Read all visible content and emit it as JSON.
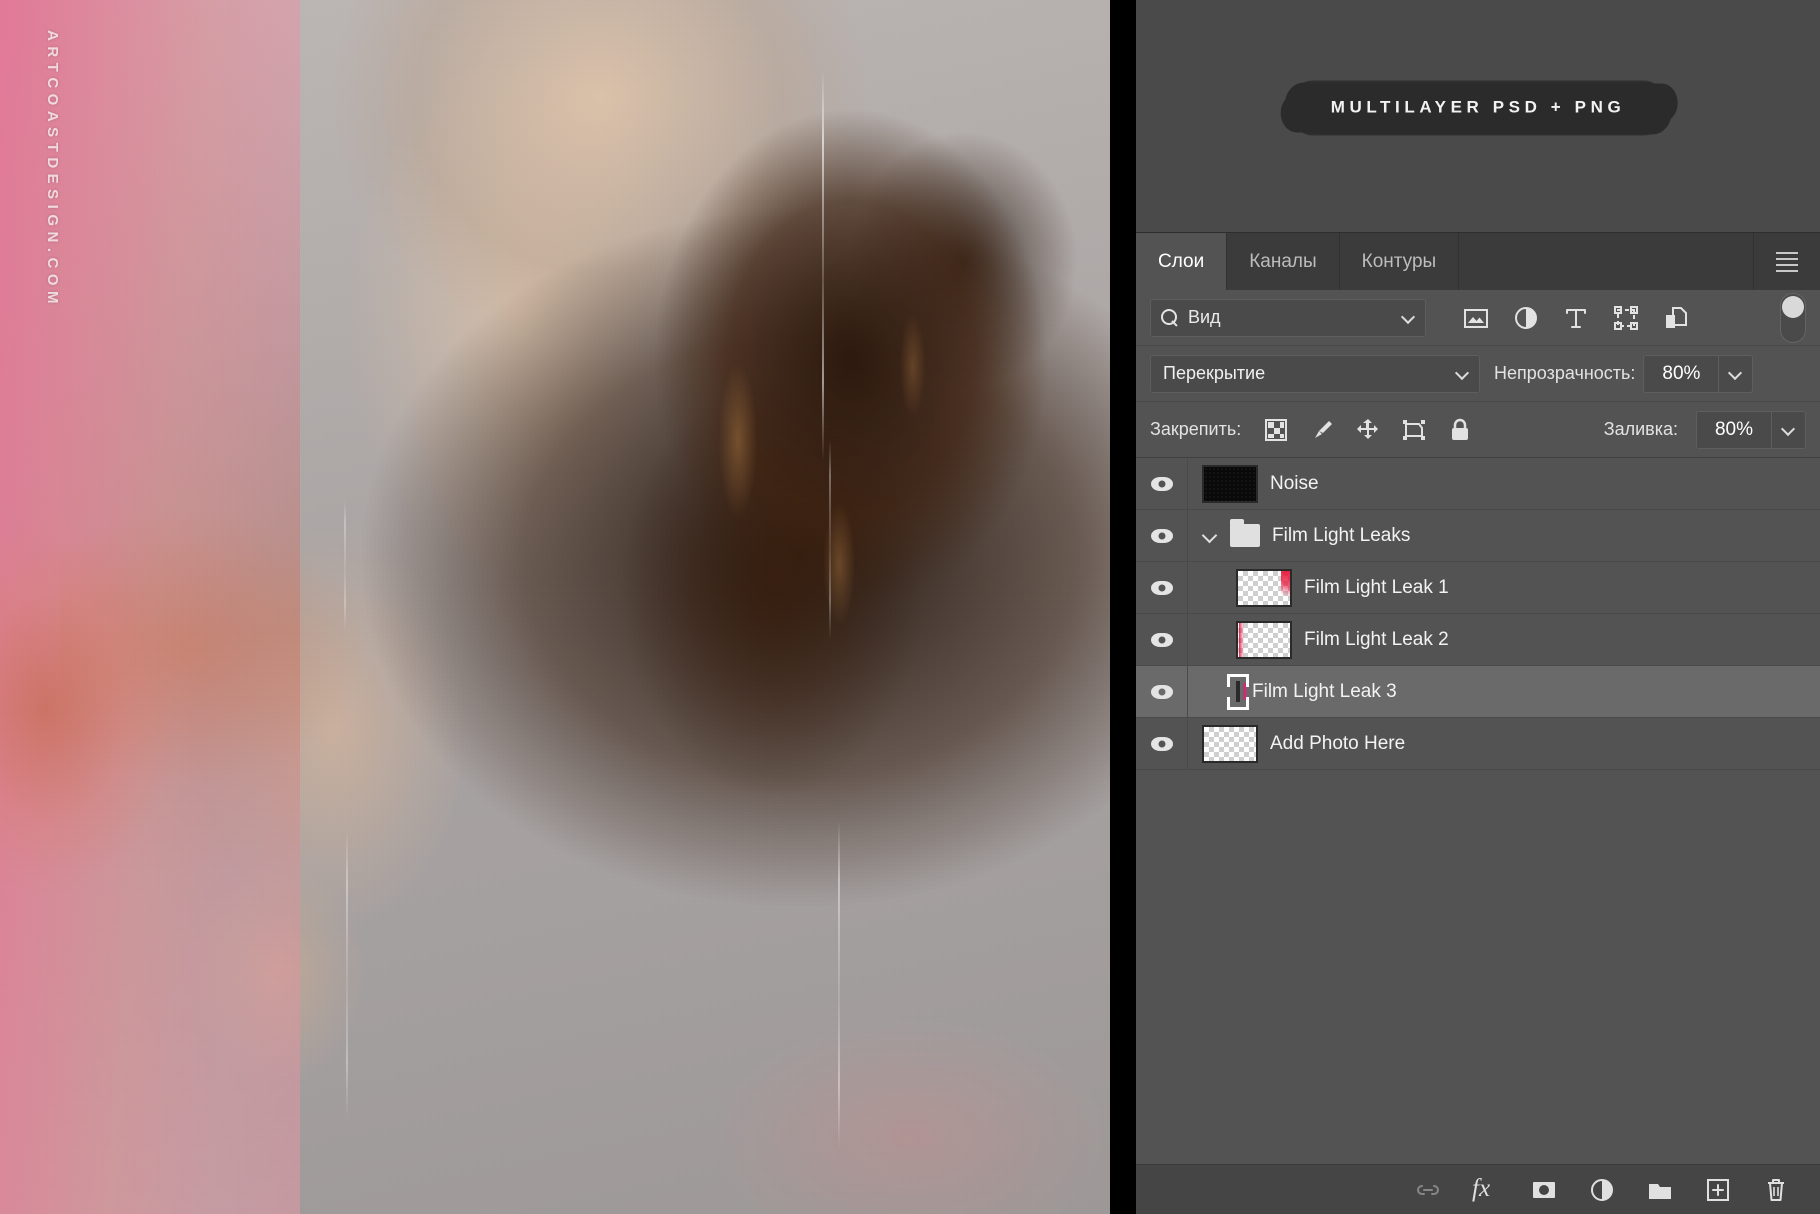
{
  "preview": {
    "watermark": "ARTCOASTDESIGN.COM",
    "alt": "woman lying face down on grey bedsheets with pink film light leak"
  },
  "promo": {
    "badge_label": "MULTILAYER PSD + PNG",
    "badge_bg": "#2b2b2b",
    "badge_text_color": "#f2f2f2"
  },
  "panel": {
    "tabs": [
      {
        "label": "Слои",
        "active": true
      },
      {
        "label": "Каналы",
        "active": false
      },
      {
        "label": "Контуры",
        "active": false
      }
    ],
    "menu_icon": "hamburger-menu-icon",
    "filter": {
      "search_icon": "search-icon",
      "value": "Вид",
      "chevron": "chevron-down-icon",
      "type_icons": [
        "pixel-layer-filter-icon",
        "adjustment-layer-filter-icon",
        "type-layer-filter-icon",
        "shape-layer-filter-icon",
        "smart-object-filter-icon"
      ],
      "toggle": "filter-enable-toggle"
    },
    "blend": {
      "mode": "Перекрытие",
      "opacity_label": "Непрозрачность:",
      "opacity_value": "80%"
    },
    "lock": {
      "label": "Закрепить:",
      "icons": [
        "lock-transparency-icon",
        "lock-image-pixels-icon",
        "lock-position-icon",
        "lock-artboard-nesting-icon",
        "lock-all-icon"
      ],
      "fill_label": "Заливка:",
      "fill_value": "80%"
    },
    "layers": [
      {
        "name": "Noise",
        "visible": true,
        "selected": false,
        "indent": false,
        "thumb": "black",
        "kind": "layer"
      },
      {
        "name": "Film Light Leaks",
        "visible": true,
        "selected": false,
        "indent": false,
        "thumb": "folder",
        "kind": "group",
        "expanded": true
      },
      {
        "name": "Film Light Leak 1",
        "visible": true,
        "selected": false,
        "indent": true,
        "thumb": "leak-right",
        "kind": "layer"
      },
      {
        "name": "Film Light Leak 2",
        "visible": true,
        "selected": false,
        "indent": true,
        "thumb": "leak-left",
        "kind": "layer"
      },
      {
        "name": "Film Light Leak 3",
        "visible": true,
        "selected": true,
        "indent": true,
        "thumb": "leak-stripe",
        "kind": "layer"
      },
      {
        "name": "Add Photo Here",
        "visible": true,
        "selected": false,
        "indent": false,
        "thumb": "empty",
        "kind": "layer"
      }
    ],
    "bottom_tools": [
      {
        "name": "link-layers-icon",
        "disabled": true
      },
      {
        "name": "layer-style-fx-icon",
        "disabled": false
      },
      {
        "name": "add-layer-mask-icon",
        "disabled": false
      },
      {
        "name": "new-adjustment-layer-icon",
        "disabled": false
      },
      {
        "name": "new-group-icon",
        "disabled": false
      },
      {
        "name": "new-layer-icon",
        "disabled": false
      },
      {
        "name": "delete-layer-icon",
        "disabled": false
      }
    ],
    "colors": {
      "panel_bg": "#454545",
      "list_bg": "#535353",
      "selected_row": "#6a6a6a",
      "tab_bar": "#3b3b3b",
      "text": "#f3f3f3",
      "leak_accent": "#e81c3e"
    }
  }
}
